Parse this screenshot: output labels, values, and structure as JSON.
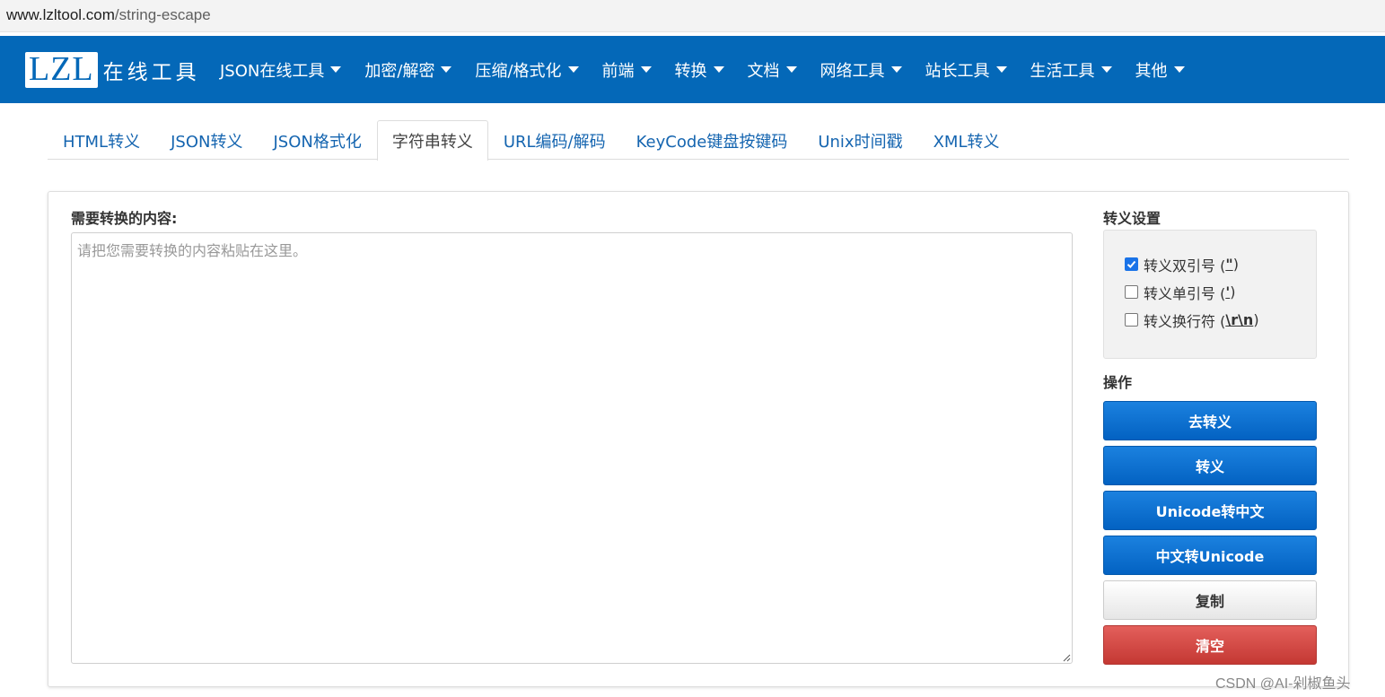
{
  "browser": {
    "url_host": "www.lzltool.com",
    "url_path": "/string-escape"
  },
  "navbar": {
    "logo_box": "LZL",
    "logo_text": "在线工具",
    "items": [
      {
        "label": "JSON在线工具"
      },
      {
        "label": "加密/解密"
      },
      {
        "label": "压缩/格式化"
      },
      {
        "label": "前端"
      },
      {
        "label": "转换"
      },
      {
        "label": "文档"
      },
      {
        "label": "网络工具"
      },
      {
        "label": "站长工具"
      },
      {
        "label": "生活工具"
      },
      {
        "label": "其他"
      }
    ]
  },
  "tabs": [
    {
      "label": "HTML转义",
      "active": false
    },
    {
      "label": "JSON转义",
      "active": false
    },
    {
      "label": "JSON格式化",
      "active": false
    },
    {
      "label": "字符串转义",
      "active": true
    },
    {
      "label": "URL编码/解码",
      "active": false
    },
    {
      "label": "KeyCode键盘按键码",
      "active": false
    },
    {
      "label": "Unix时间戳",
      "active": false
    },
    {
      "label": "XML转义",
      "active": false
    }
  ],
  "input": {
    "label": "需要转换的内容:",
    "placeholder": "请把您需要转换的内容粘贴在这里。",
    "value": ""
  },
  "settings": {
    "title": "转义设置",
    "options": [
      {
        "label": "转义双引号 ( ",
        "code": "\"",
        "suffix": " )",
        "checked": true
      },
      {
        "label": "转义单引号 ( ",
        "code": "'",
        "suffix": " )",
        "checked": false
      },
      {
        "label": "转义换行符 ( ",
        "code": "\\r\\n",
        "suffix": " )",
        "checked": false
      }
    ]
  },
  "actions": {
    "title": "操作",
    "unescape": "去转义",
    "escape": "转义",
    "unicode_to_cn": "Unicode转中文",
    "cn_to_unicode": "中文转Unicode",
    "copy": "复制",
    "clear": "清空"
  },
  "watermark": "CSDN @AI-剁椒鱼头",
  "colors": {
    "brand": "#0468b8",
    "primary_button": "#0a6fd0",
    "danger_button": "#d44b46",
    "tab_link": "#1565b0"
  }
}
